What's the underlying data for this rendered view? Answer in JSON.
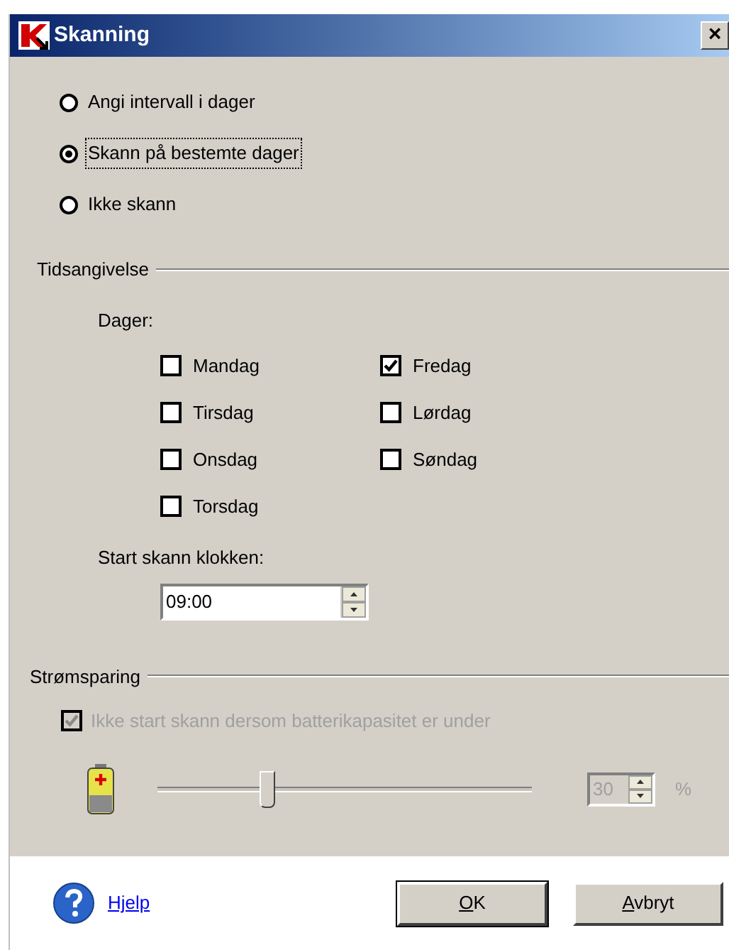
{
  "window": {
    "title": "Skanning",
    "close": "×"
  },
  "schedule_options": [
    {
      "label": "Angi intervall i dager",
      "selected": false,
      "focused": false
    },
    {
      "label": "Skann på bestemte dager",
      "selected": true,
      "focused": true
    },
    {
      "label": "Ikke skann",
      "selected": false,
      "focused": false
    }
  ],
  "time_section": {
    "title": "Tidsangivelse",
    "days_label": "Dager:",
    "days_left": [
      {
        "label": "Mandag",
        "checked": false
      },
      {
        "label": "Tirsdag",
        "checked": false
      },
      {
        "label": "Onsdag",
        "checked": false
      },
      {
        "label": "Torsdag",
        "checked": false
      }
    ],
    "days_right": [
      {
        "label": "Fredag",
        "checked": true
      },
      {
        "label": "Lørdag",
        "checked": false
      },
      {
        "label": "Søndag",
        "checked": false
      }
    ],
    "start_label": "Start skann klokken:",
    "start_time": "09:00"
  },
  "power_section": {
    "title": "Strømsparing",
    "checkbox": {
      "label": "Ikke start skann dersom batterikapasitet er under",
      "checked": true,
      "disabled": true
    },
    "slider": {
      "level": 0.29,
      "disabled": true
    },
    "value": "30",
    "unit": "%"
  },
  "footer": {
    "help_link": "Hjelp",
    "buttons": [
      {
        "label": "OK",
        "default": true,
        "mnemonic": true
      },
      {
        "label": "Avbryt",
        "default": false,
        "mnemonic": true
      }
    ]
  }
}
